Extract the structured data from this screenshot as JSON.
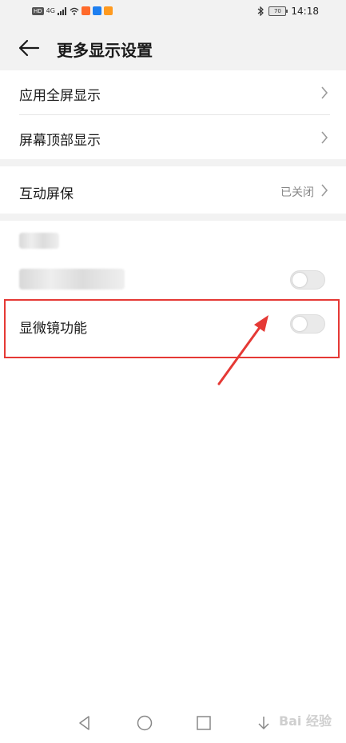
{
  "status_bar": {
    "left_badge": "HD",
    "network": "4G",
    "time": "14:18",
    "battery": "70"
  },
  "header": {
    "title": "更多显示设置"
  },
  "settings": {
    "group1": [
      {
        "label": "应用全屏显示"
      },
      {
        "label": "屏幕顶部显示"
      }
    ],
    "group2": [
      {
        "label": "互动屏保",
        "value": "已关闭"
      }
    ],
    "group3": {
      "microscope_label": "显微镜功能"
    }
  },
  "colors": {
    "background_band": "#f2f2f2",
    "highlight": "#e53935",
    "toggle_off": "#eaeaea"
  },
  "watermark": "Bai 经验"
}
